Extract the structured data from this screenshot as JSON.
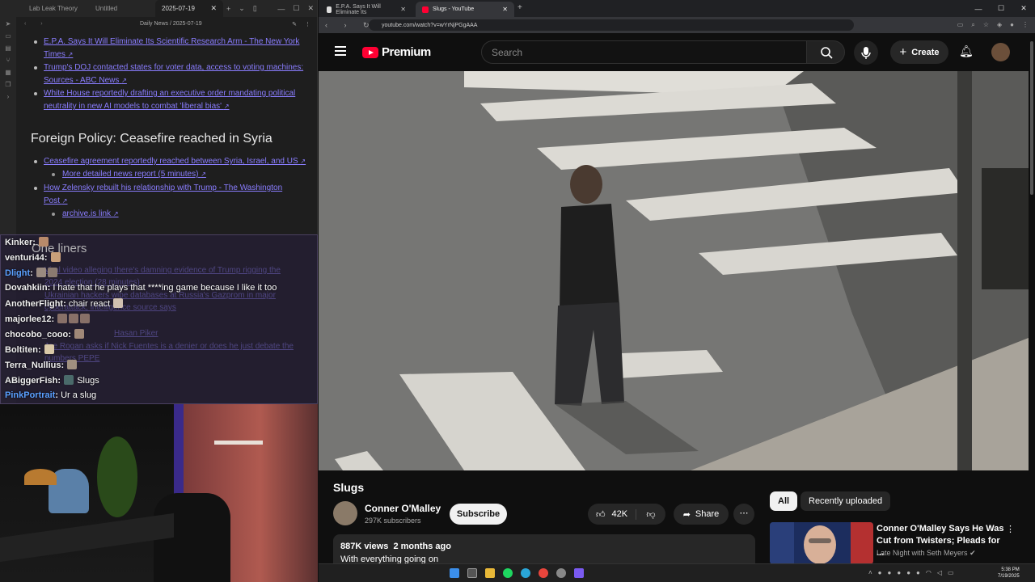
{
  "obsidian": {
    "tabs": [
      {
        "label": "Lab Leak Theory"
      },
      {
        "label": "Untitled"
      },
      {
        "label": "2025-07-19"
      }
    ],
    "breadcrumb": "Daily News / 2025-07-19",
    "top_links": [
      "E.P.A. Says It Will Eliminate Its Scientific Research Arm - The New York",
      "Times",
      "Trump's DOJ contacted states for voter data, access to voting machines:",
      "Sources - ABC News",
      "White House reportedly drafting an executive order mandating political",
      "neutrality in new AI models to combat 'liberal bias'"
    ],
    "heading_foreign": "Foreign Policy: Ceasefire reached in Syria",
    "foreign_links": [
      "Ceasefire agreement reportedly reached between Syria, Israel, and US",
      "More detailed news report (5 minutes)",
      "How Zelensky rebuilt his relationship with Trump - The Washington",
      "Post",
      "archive.is link"
    ],
    "heading_oneliners": "One liners"
  },
  "chat": {
    "messages": [
      {
        "user": "Kinker",
        "text": ""
      },
      {
        "user": "venturi44",
        "text": ""
      },
      {
        "user": "Dlight",
        "text": ""
      },
      {
        "user": "Dovahkiin",
        "text": "I hate that he plays that ****ing game because I like it too"
      },
      {
        "user": "AnotherFlight",
        "text": "chair react"
      },
      {
        "user": "majorlee12",
        "text": ""
      },
      {
        "user": "chocobo_cooo",
        "text": ""
      },
      {
        "user": "Boltiten",
        "text": ""
      },
      {
        "user": "Terra_Nullius",
        "text": ""
      },
      {
        "user": "ABiggerFish",
        "text": "Slugs"
      },
      {
        "user": "PinkPortrait",
        "text": "Ur a slug"
      }
    ],
    "bg_links": [
      "Viral video alleging there's damning evidence of Trump rigging the",
      "2024 election (28 minutes)",
      "Ukrainian hackers wipe databases at Russia's Gazprom in major",
      "cyberattack, intelligence source says",
      "Joe Rogan asks if Nick Fuentes is a denier or does he just debate the",
      "numbers PEPE",
      "Hasan Piker"
    ]
  },
  "browser": {
    "tabs": [
      {
        "label": "E.P.A. Says It Will Eliminate Its"
      },
      {
        "label": "Slugs - YouTube"
      }
    ],
    "url": "youtube.com/watch?v=wYrNjPGgAAA"
  },
  "youtube": {
    "logo_text": "Premium",
    "search_placeholder": "Search",
    "create_label": "Create",
    "video_title": "Slugs",
    "channel_name": "Conner O'Malley",
    "subscribers": "297K subscribers",
    "subscribe_label": "Subscribe",
    "likes": "42K",
    "share_label": "Share",
    "views": "887K views",
    "age": "2 months ago",
    "description": "With everything going on",
    "chips": [
      "All",
      "Recently uploaded"
    ],
    "related": {
      "title": "Conner O'Malley Says He Was Cut from Twisters; Pleads for ...",
      "channel": "Late Night with Seth Meyers"
    }
  },
  "taskbar": {
    "time": "5:38 PM",
    "date": "7/19/2025"
  },
  "colors": {
    "yt_red": "#ff0033",
    "obsidian_link": "#8a7dff",
    "chat_user_blue": "#5aa0ff"
  }
}
